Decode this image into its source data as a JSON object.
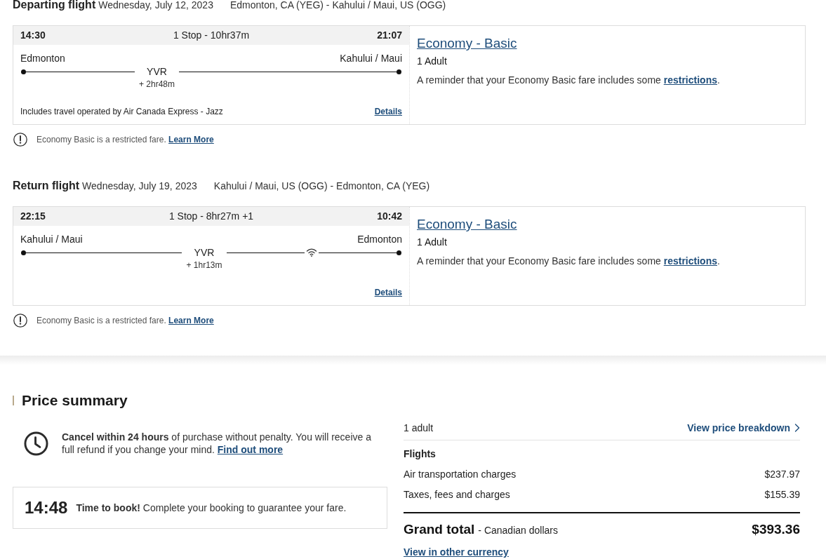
{
  "flights": [
    {
      "heading": "Departing flight",
      "date": "Wednesday, July 12, 2023",
      "route": "Edmonton, CA (YEG) - Kahului / Maui, US (OGG)",
      "itinerary": {
        "departure_time": "14:30",
        "summary": "1 Stop - 10hr37m",
        "arrival_time": "21:07",
        "origin": "Edmonton",
        "destination": "Kahului / Maui",
        "stops": [
          {
            "code": "YVR",
            "layover": "+ 2hr48m"
          }
        ],
        "wifi": false,
        "operator_note": "Includes travel operated by Air Canada Express - Jazz",
        "details_link": "Details"
      },
      "fare": {
        "cabin": "Economy - Basic",
        "passengers": "1 Adult",
        "reminder": {
          "before": "A reminder that your Economy Basic fare includes some ",
          "link": "restrictions",
          "after": "."
        }
      },
      "notice": {
        "text": "Economy Basic is a restricted fare.",
        "link": "Learn More"
      }
    },
    {
      "heading": "Return flight",
      "date": "Wednesday, July 19, 2023",
      "route": "Kahului / Maui, US (OGG) - Edmonton, CA (YEG)",
      "itinerary": {
        "departure_time": "22:15",
        "summary": "1 Stop - 8hr27m +1",
        "arrival_time": "10:42",
        "origin": "Kahului / Maui",
        "destination": "Edmonton",
        "stops": [
          {
            "code": "YVR",
            "layover": "+ 1hr13m"
          }
        ],
        "wifi": true,
        "details_link": "Details"
      },
      "fare": {
        "cabin": "Economy - Basic",
        "passengers": "1 Adult",
        "reminder": {
          "before": "A reminder that your Economy Basic fare includes some ",
          "link": "restrictions",
          "after": "."
        }
      },
      "notice": {
        "text": "Economy Basic is a restricted fare.",
        "link": "Learn More"
      }
    }
  ],
  "price_summary": {
    "title": "Price summary",
    "cancel_policy": {
      "text": "**Cancel within 24 hours** of purchase without penalty. You will receive a full refund if you change your mind.",
      "link": "Find out more"
    },
    "timer": {
      "time": "14:48",
      "message": "**Time to book!** Complete your booking to guarantee your fare."
    },
    "breakdown": {
      "passengers": "1 adult",
      "breakdown_link": "View price breakdown",
      "group": "Flights",
      "lines": [
        {
          "label": "Air transportation charges",
          "amount": "$237.97"
        },
        {
          "label": "Taxes, fees and charges",
          "amount": "$155.39"
        }
      ],
      "total": {
        "label": "Grand total",
        "note": "- Canadian dollars",
        "amount": "$393.36"
      },
      "currency_link": "View in other currency"
    }
  }
}
